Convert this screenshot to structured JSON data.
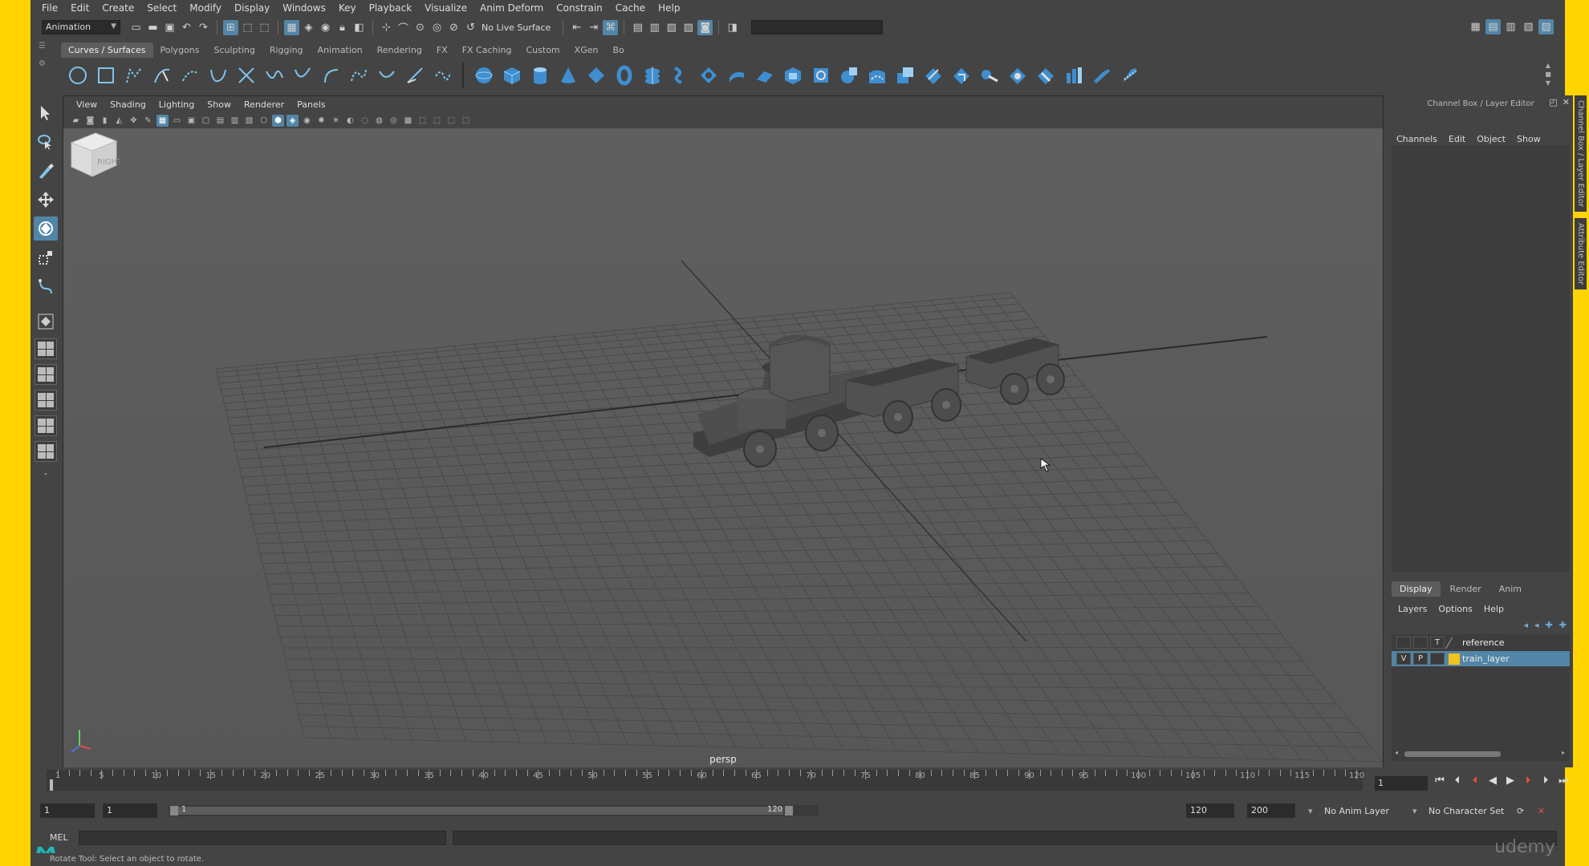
{
  "menubar": [
    "File",
    "Edit",
    "Create",
    "Select",
    "Modify",
    "Display",
    "Windows",
    "Key",
    "Playback",
    "Visualize",
    "Anim Deform",
    "Constrain",
    "Cache",
    "Help"
  ],
  "statusline": {
    "mode": "Animation",
    "live_surface": "No Live Surface"
  },
  "shelf": {
    "tabs": [
      "Curves / Surfaces",
      "Polygons",
      "Sculpting",
      "Rigging",
      "Animation",
      "Rendering",
      "FX",
      "FX Caching",
      "Custom",
      "XGen",
      "Bo"
    ],
    "active_tab": "Curves / Surfaces"
  },
  "viewport": {
    "menu": [
      "View",
      "Shading",
      "Lighting",
      "Show",
      "Renderer",
      "Panels"
    ],
    "camera_label": "persp",
    "viewcube_face": "RIGHT"
  },
  "channel_box": {
    "title": "Channel Box / Layer Editor",
    "menu": [
      "Channels",
      "Edit",
      "Object",
      "Show"
    ],
    "tabs": [
      "Display",
      "Render",
      "Anim"
    ],
    "active_tab": "Display",
    "layer_menu": [
      "Layers",
      "Options",
      "Help"
    ],
    "layers": [
      {
        "v": "",
        "p": "",
        "t": "T",
        "name": "reference",
        "color": "",
        "selected": false
      },
      {
        "v": "V",
        "p": "P",
        "t": "",
        "name": "train_layer",
        "color": "#f2c21d",
        "selected": true
      }
    ],
    "side_tabs": [
      "Channel Box / Layer Editor",
      "Attribute Editor"
    ]
  },
  "timeslider": {
    "labels": [
      "1",
      "5",
      "10",
      "15",
      "20",
      "25",
      "30",
      "35",
      "40",
      "45",
      "50",
      "55",
      "60",
      "65",
      "70",
      "75",
      "80",
      "85",
      "90",
      "95",
      "100",
      "105",
      "110",
      "115",
      "120"
    ],
    "current_frame": "1"
  },
  "rangebar": {
    "start": "1",
    "playback_start": "1",
    "range_start_label": "1",
    "range_end_label": "120",
    "playback_end": "120",
    "end": "200",
    "anim_layer": "No Anim Layer",
    "character_set": "No Character Set"
  },
  "cmdline": {
    "language": "MEL"
  },
  "helpline": "Rotate Tool: Select an object to rotate.",
  "watermark": "udemy"
}
